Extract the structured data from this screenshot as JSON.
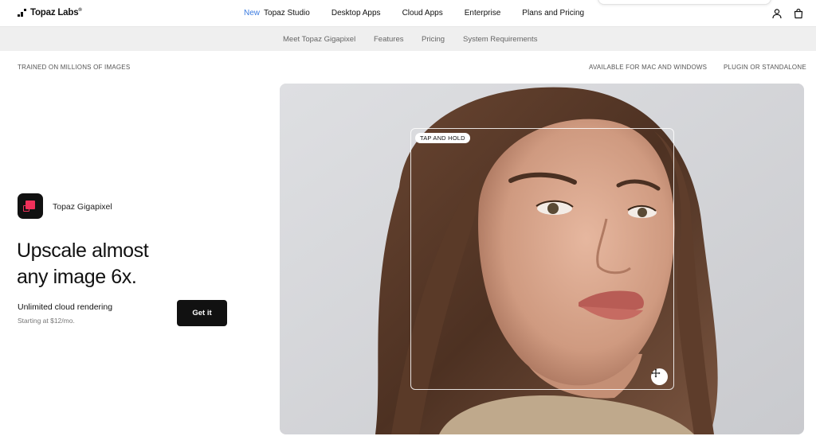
{
  "nav": {
    "brand": "Topaz Labs",
    "brand_mark": "®",
    "new_label": "New",
    "links": [
      "Topaz Studio",
      "Desktop Apps",
      "Cloud Apps",
      "Enterprise",
      "Plans and Pricing"
    ],
    "icons": [
      "account-icon",
      "cart-icon"
    ]
  },
  "subnav": {
    "links": [
      "Meet Topaz Gigapixel",
      "Features",
      "Pricing",
      "System Requirements"
    ]
  },
  "strip": {
    "left": "TRAINED ON MILLIONS OF IMAGES",
    "right1": "AVAILABLE FOR MAC AND WINDOWS",
    "right2": "PLUGIN OR STANDALONE"
  },
  "hero": {
    "app_name": "Topaz Gigapixel",
    "headline_line1": "Upscale almost",
    "headline_line2": "any image 6x.",
    "plan_title": "Unlimited cloud rendering",
    "plan_sub": "Starting at $12/mo.",
    "cta_label": "Get it"
  },
  "preview": {
    "badge": "TAP AND HOLD",
    "handle_icon": "move-icon"
  },
  "colors": {
    "accent_new": "#3b7be0",
    "app_icon_accent": "#f0305a",
    "button_bg": "#111111"
  }
}
